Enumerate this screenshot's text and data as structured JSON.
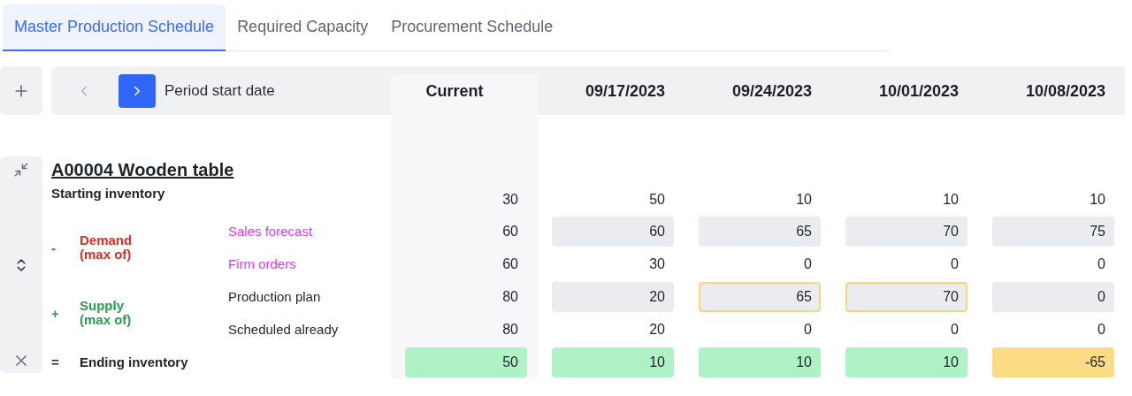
{
  "tabs": [
    {
      "label": "Master Production Schedule",
      "selected": true
    },
    {
      "label": "Required Capacity",
      "selected": false
    },
    {
      "label": "Procurement Schedule",
      "selected": false
    }
  ],
  "toolbar": {
    "period_label": "Period start date",
    "prev_disabled": true
  },
  "columns": [
    "Current",
    "09/17/2023",
    "09/24/2023",
    "10/01/2023",
    "10/08/2023"
  ],
  "item": {
    "title": "A00004 Wooden table",
    "starting_inventory": {
      "label": "Starting inventory",
      "cells": [
        {
          "kind": "plain",
          "value": "30"
        },
        {
          "kind": "plain",
          "value": "50"
        },
        {
          "kind": "plain",
          "value": "10"
        },
        {
          "kind": "plain",
          "value": "10"
        },
        {
          "kind": "plain",
          "value": "10"
        }
      ]
    },
    "groups": [
      {
        "sign": "-",
        "label": "Demand\n(max of)",
        "color": "#d93025",
        "rows": [
          {
            "label": "Sales forecast",
            "color": "#d63bf0",
            "cells": [
              {
                "kind": "plain",
                "value": "60"
              },
              {
                "kind": "input",
                "changed": false,
                "value": "60"
              },
              {
                "kind": "input",
                "changed": false,
                "value": "65"
              },
              {
                "kind": "input",
                "changed": false,
                "value": "70"
              },
              {
                "kind": "input",
                "changed": false,
                "value": "75"
              }
            ]
          },
          {
            "label": "Firm orders",
            "color": "#d63bf0",
            "cells": [
              {
                "kind": "plain",
                "value": "60"
              },
              {
                "kind": "plain",
                "value": "30"
              },
              {
                "kind": "plain",
                "value": "0"
              },
              {
                "kind": "plain",
                "value": "0"
              },
              {
                "kind": "plain",
                "value": "0"
              }
            ]
          }
        ]
      },
      {
        "sign": "+",
        "label": "Supply\n(max of)",
        "color": "#2e9a4f",
        "rows": [
          {
            "label": "Production plan",
            "color": "#1f2328",
            "cells": [
              {
                "kind": "plain",
                "value": "80"
              },
              {
                "kind": "input",
                "changed": false,
                "value": "20"
              },
              {
                "kind": "input",
                "changed": true,
                "value": "65"
              },
              {
                "kind": "input",
                "changed": true,
                "value": "70"
              },
              {
                "kind": "input",
                "changed": false,
                "value": "0"
              }
            ]
          },
          {
            "label": "Scheduled already",
            "color": "#1f2328",
            "cells": [
              {
                "kind": "plain",
                "value": "80"
              },
              {
                "kind": "plain",
                "value": "20"
              },
              {
                "kind": "plain",
                "value": "0"
              },
              {
                "kind": "plain",
                "value": "0"
              },
              {
                "kind": "plain",
                "value": "0"
              }
            ]
          }
        ]
      }
    ],
    "ending_inventory": {
      "sign": "=",
      "label": "Ending inventory",
      "cells": [
        {
          "kind": "status",
          "color": "#aef2c6",
          "value": "50"
        },
        {
          "kind": "status",
          "color": "#aef2c6",
          "value": "10"
        },
        {
          "kind": "status",
          "color": "#aef2c6",
          "value": "10"
        },
        {
          "kind": "status",
          "color": "#aef2c6",
          "value": "10"
        },
        {
          "kind": "status",
          "color": "#fbdc85",
          "value": "-65"
        }
      ]
    }
  }
}
